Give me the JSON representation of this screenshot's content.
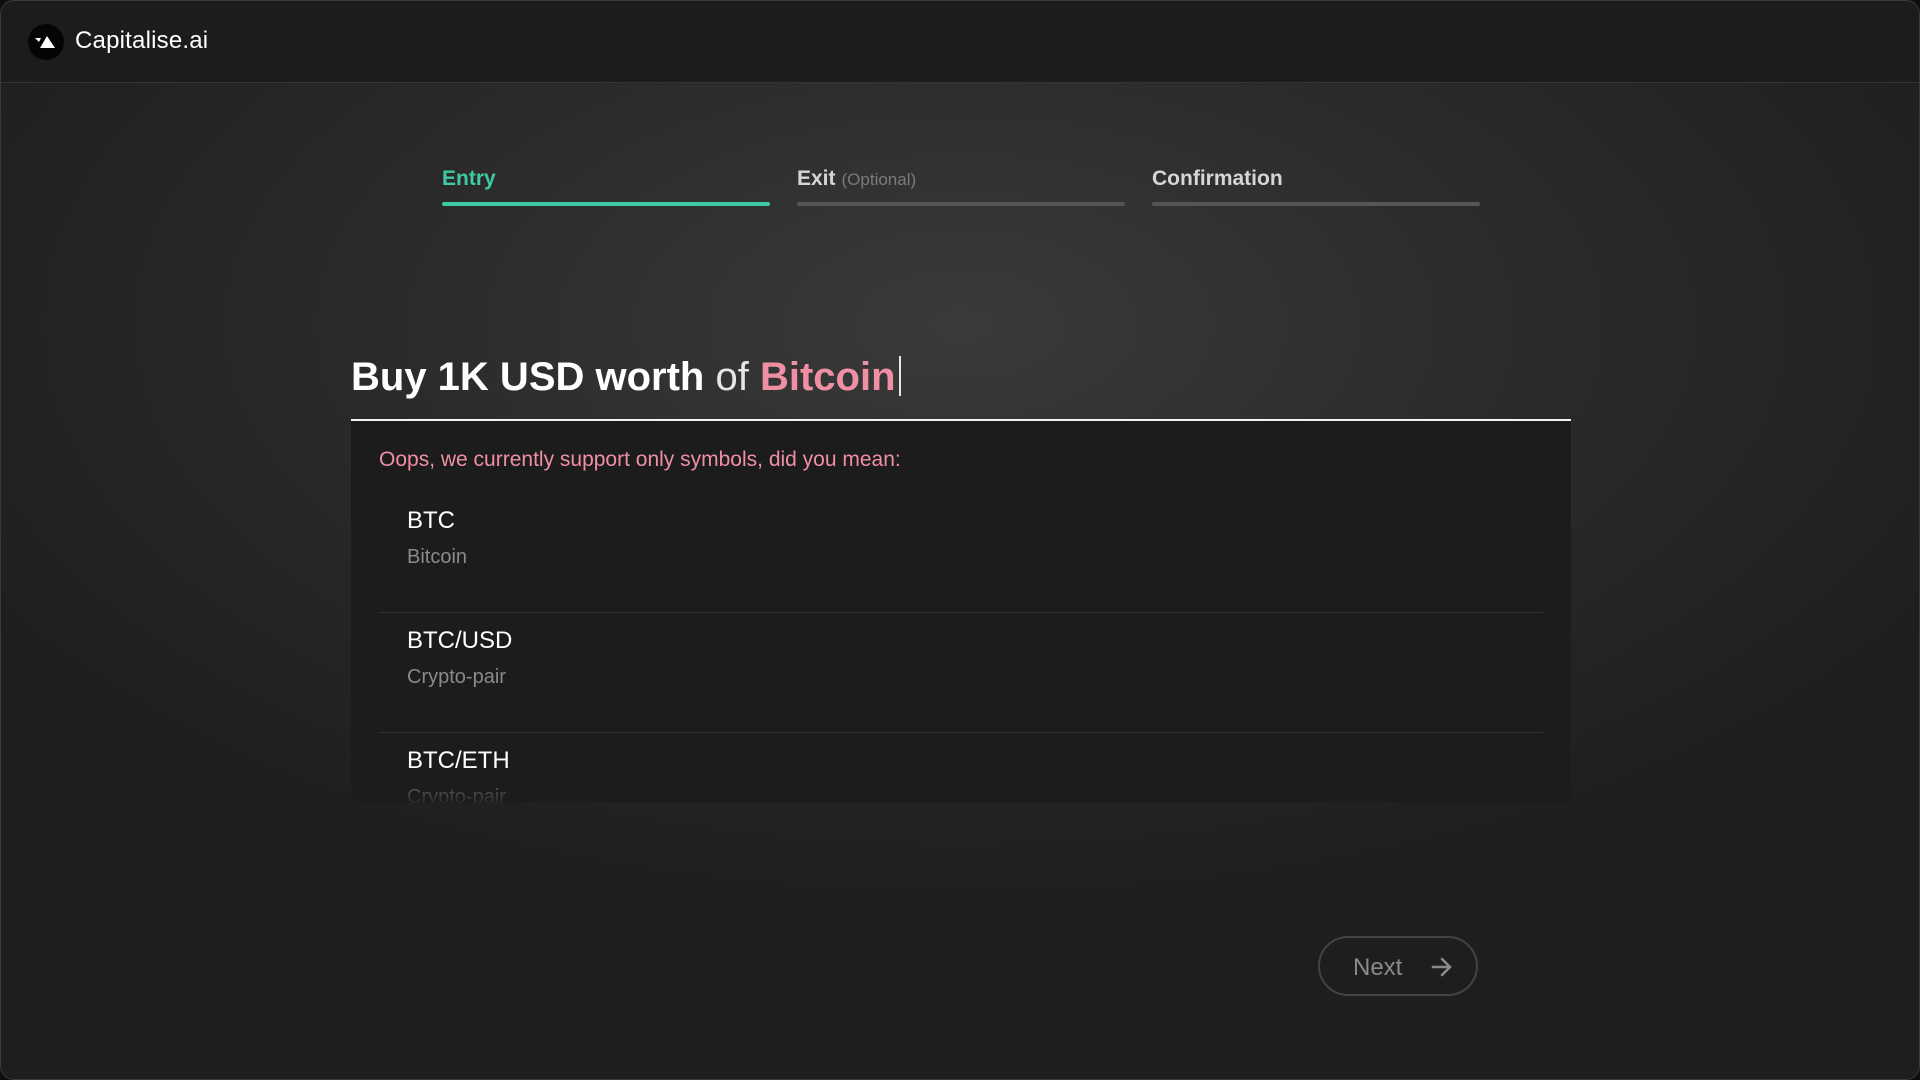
{
  "app": {
    "name": "Capitalise.ai"
  },
  "steps": [
    {
      "label": "Entry",
      "suffix": "",
      "state": "active"
    },
    {
      "label": "Exit",
      "suffix": "(Optional)",
      "state": "inactive"
    },
    {
      "label": "Confirmation",
      "suffix": "",
      "state": "inactive"
    }
  ],
  "query": {
    "part1": "Buy 1K USD worth",
    "part2": "of",
    "part3": "Bitcoin"
  },
  "suggestions": {
    "message": "Oops, we currently support only symbols, did you mean:",
    "items": [
      {
        "symbol": "BTC",
        "type": "Bitcoin"
      },
      {
        "symbol": "BTC/USD",
        "type": "Crypto-pair"
      },
      {
        "symbol": "BTC/ETH",
        "type": "Crypto-pair"
      }
    ]
  },
  "footer": {
    "next_label": "Next",
    "next_icon": "arrow-right-icon"
  },
  "colors": {
    "accent_green": "#3ecba3",
    "accent_pink": "#ef8fa4",
    "background": "#2c2c2c"
  }
}
